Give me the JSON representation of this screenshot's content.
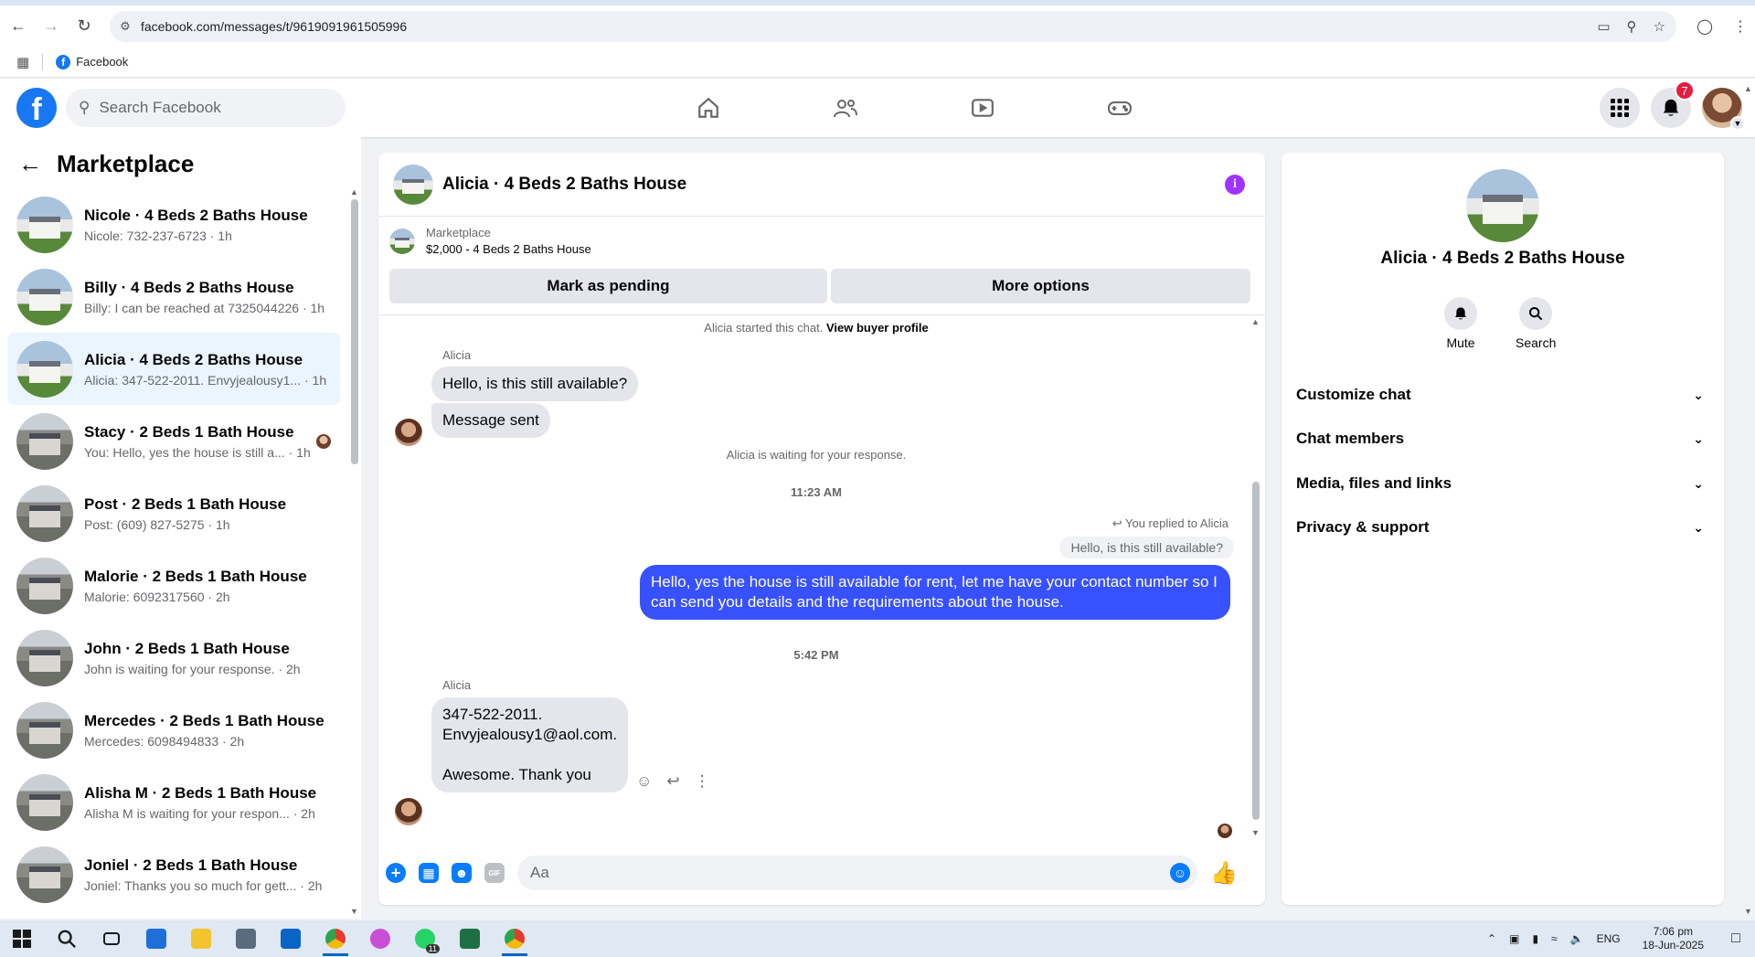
{
  "browser": {
    "url": "facebook.com/messages/t/9619091961505996",
    "bookmark_label": "Facebook"
  },
  "fb": {
    "logo_letter": "f",
    "search_placeholder": "Search Facebook",
    "notification_count": "7"
  },
  "sidebar": {
    "title": "Marketplace",
    "conversations": [
      {
        "title": "Nicole · 4 Beds 2 Baths House",
        "subtitle": "Nicole: 732-237-6723 · 1h"
      },
      {
        "title": "Billy · 4 Beds 2 Baths House",
        "subtitle": "Billy: I can be reached at 7325044226 · 1h"
      },
      {
        "title": "Alicia · 4 Beds 2 Baths House",
        "subtitle": "Alicia: 347-522-2011. Envyjealousy1... · 1h"
      },
      {
        "title": "Stacy · 2 Beds 1 Bath House",
        "subtitle": "You: Hello, yes the house is still a... · 1h"
      },
      {
        "title": "Post · 2 Beds 1 Bath House",
        "subtitle": "Post: (609) 827-5275 · 1h"
      },
      {
        "title": "Malorie · 2 Beds 1 Bath House",
        "subtitle": "Malorie: 6092317560 · 2h"
      },
      {
        "title": "John · 2 Beds 1 Bath House",
        "subtitle": "John is waiting for your response. · 2h"
      },
      {
        "title": "Mercedes · 2 Beds 1 Bath House",
        "subtitle": "Mercedes: 6098494833 · 2h"
      },
      {
        "title": "Alisha M · 2 Beds 1 Bath House",
        "subtitle": "Alisha M is waiting for your respon... · 2h"
      },
      {
        "title": "Joniel · 2 Beds 1 Bath House",
        "subtitle": "Joniel: Thanks you so much for gett... · 2h"
      }
    ]
  },
  "chat": {
    "title": "Alicia · 4 Beds 2 Baths House",
    "listing_source": "Marketplace",
    "listing_detail": "$2,000 - 4 Beds 2 Baths House",
    "mark_pending_label": "Mark as pending",
    "more_options_label": "More options",
    "started_text": "Alicia started this chat.",
    "buyer_profile_link": "View buyer profile",
    "sender_name": "Alicia",
    "msg1": "Hello, is this still available?",
    "msg2": "Message sent",
    "waiting_text": "Alicia is waiting for your response.",
    "time1": "11:23 AM",
    "replied_to": "You replied to Alicia",
    "reply_quote": "Hello, is this still available?",
    "out_line1": "Hello, yes the house is still available for rent, let me have your contact number so I",
    "out_line2": "can send you details and the requirements about the house.",
    "time2": "5:42 PM",
    "msg3_line1": "347-522-2011.",
    "msg3_line2": "Envyjealousy1@aol.com.",
    "msg3_line3": "Awesome.   Thank you",
    "composer_placeholder": "Aa",
    "gif_label": "GIF"
  },
  "info_panel": {
    "name": "Alicia · 4 Beds 2 Baths House",
    "mute_label": "Mute",
    "search_label": "Search",
    "sections": [
      "Customize chat",
      "Chat members",
      "Media, files and links",
      "Privacy & support"
    ]
  },
  "taskbar": {
    "language": "ENG",
    "time": "7:06 pm",
    "date": "18-Jun-2025",
    "whatsapp_badge": "11"
  },
  "colors": {
    "fb_blue": "#1877f2",
    "outgoing_bubble": "#3751ff",
    "active_conversation": "#ebf5ff",
    "info_icon": "#a033ff"
  }
}
